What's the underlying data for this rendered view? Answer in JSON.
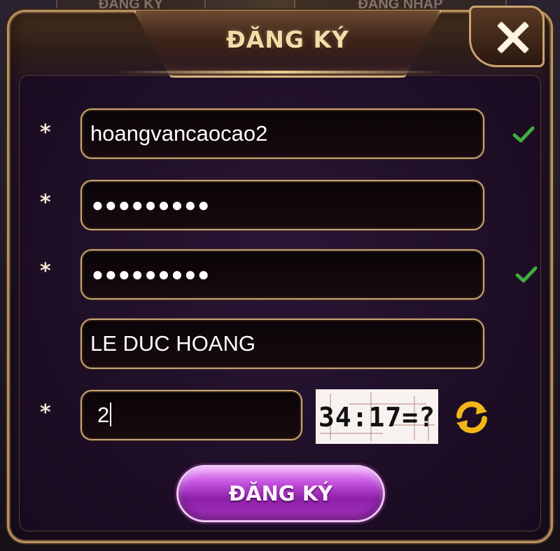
{
  "background": {
    "tabs": [
      {
        "label": "ĐĂNG KÝ"
      },
      {
        "label": "ĐĂNG NHẬP"
      }
    ]
  },
  "dialog": {
    "title": "ĐĂNG KÝ",
    "close_icon": "close-icon",
    "required_marker": "*"
  },
  "form": {
    "username": {
      "value": "hoangvancaocao2",
      "valid": true
    },
    "password": {
      "value": "●●●●●●●●●",
      "valid": null
    },
    "confirm_password": {
      "value": "●●●●●●●●●",
      "valid": true
    },
    "display_name": {
      "value": "LE DUC HOANG"
    },
    "captcha_answer": {
      "value": "2"
    },
    "captcha_image_text": "34:17=?",
    "refresh_icon": "refresh-icon",
    "check_icon": "check-icon"
  },
  "submit": {
    "label": "ĐĂNG KÝ"
  },
  "colors": {
    "frame_gold": "#c7a57a",
    "title_text": "#f3dca8",
    "check_green": "#3fae3f",
    "refresh_yellow": "#f2b619",
    "submit_purple": "#a636c0"
  }
}
